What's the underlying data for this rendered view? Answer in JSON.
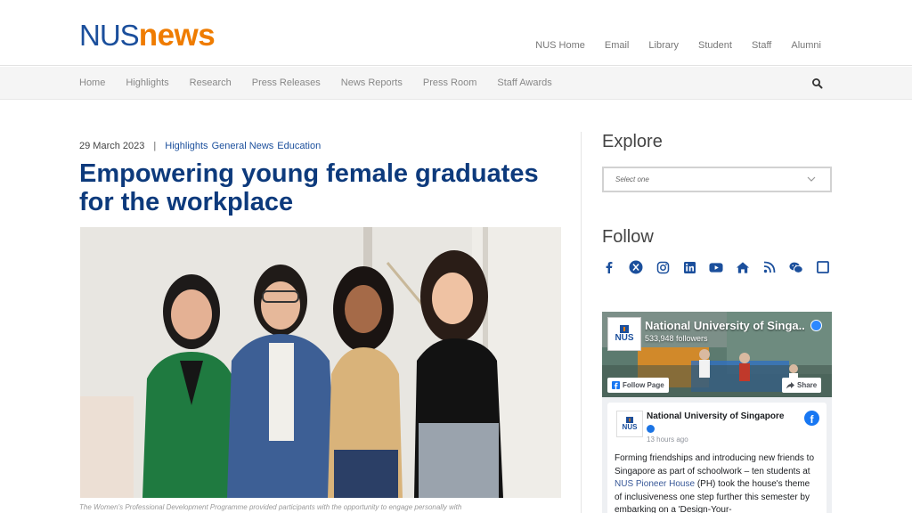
{
  "header": {
    "logo_part1": "NUS",
    "logo_part2": "news",
    "top_links": [
      "NUS Home",
      "Email",
      "Library",
      "Student",
      "Staff",
      "Alumni"
    ]
  },
  "nav": {
    "items": [
      "Home",
      "Highlights",
      "Research",
      "Press Releases",
      "News Reports",
      "Press Room",
      "Staff Awards"
    ],
    "search_icon": "search-icon"
  },
  "article": {
    "date": "29 March 2023",
    "separator": "|",
    "categories": [
      "Highlights",
      "General News",
      "Education"
    ],
    "title": "Empowering young female graduates for the workplace",
    "caption": "The Women's Professional Development Programme provided participants with the opportunity to engage personally with"
  },
  "sidebar": {
    "explore_heading": "Explore",
    "explore_placeholder": "Select one",
    "follow_heading": "Follow",
    "social_icons": [
      "facebook-icon",
      "x-icon",
      "instagram-icon",
      "linkedin-icon",
      "youtube-icon",
      "home-icon",
      "rss-icon",
      "wechat-icon",
      "square-icon"
    ]
  },
  "facebook": {
    "page_name": "National University of Singa...",
    "followers": "533,948 followers",
    "follow_label": "Follow Page",
    "share_label": "Share",
    "post_name": "National University of Singapore",
    "post_time": "13 hours ago",
    "post_text_1": "Forming friendships and introducing new friends to Singapore as part of schoolwork – ten students at ",
    "post_link": "NUS Pioneer House",
    "post_text_2": " (PH) took the house's theme of inclusiveness one step further this semester by embarking on a 'Design-Your-",
    "logo_text": "NUS"
  },
  "colors": {
    "brand_blue": "#1b4f9c",
    "brand_orange": "#ef7c00",
    "title_blue": "#0d3a7c"
  }
}
